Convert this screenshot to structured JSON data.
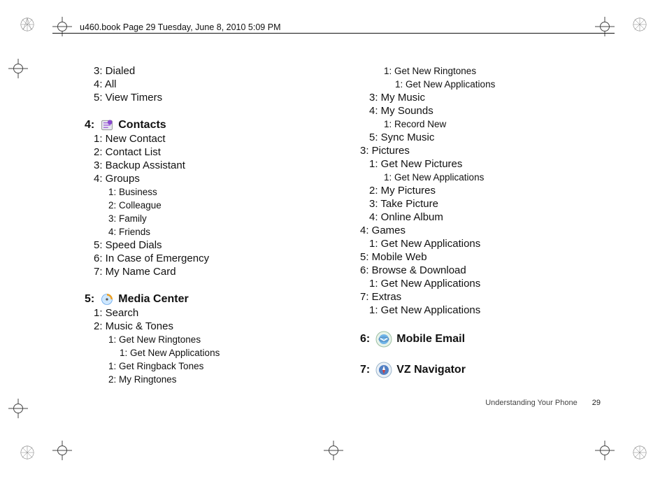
{
  "header": {
    "label": "u460.book  Page 29  Tuesday, June 8, 2010  5:09 PM"
  },
  "footer": {
    "section": "Understanding Your Phone",
    "page": "29"
  },
  "col_left": {
    "prelude": [
      {
        "lvl": 1,
        "text": "3: Dialed"
      },
      {
        "lvl": 1,
        "text": "4: All"
      },
      {
        "lvl": 1,
        "text": "5: View Timers"
      }
    ],
    "sections": [
      {
        "num": "4:",
        "title": "Contacts",
        "icon": "contacts-icon",
        "items": [
          {
            "lvl": 1,
            "text": "1: New Contact"
          },
          {
            "lvl": 1,
            "text": "2: Contact List"
          },
          {
            "lvl": 1,
            "text": "3: Backup Assistant"
          },
          {
            "lvl": 1,
            "text": "4: Groups"
          },
          {
            "lvl": 2,
            "text": "1: Business"
          },
          {
            "lvl": 2,
            "text": "2: Colleague"
          },
          {
            "lvl": 2,
            "text": "3: Family"
          },
          {
            "lvl": 2,
            "text": "4: Friends"
          },
          {
            "lvl": 1,
            "text": "5: Speed Dials"
          },
          {
            "lvl": 1,
            "text": "6: In Case of Emergency"
          },
          {
            "lvl": 1,
            "text": "7: My Name Card"
          }
        ]
      },
      {
        "num": "5:",
        "title": "Media Center",
        "icon": "media-icon",
        "items": [
          {
            "lvl": 1,
            "text": "1: Search"
          },
          {
            "lvl": 1,
            "text": "2: Music & Tones"
          },
          {
            "lvl": 2,
            "text": "1: Get New Ringtones"
          },
          {
            "lvl": 3,
            "text": "1: Get New Applications"
          },
          {
            "lvl": 2,
            "text": "1: Get Ringback Tones"
          },
          {
            "lvl": 2,
            "text": "2: My Ringtones"
          }
        ]
      }
    ]
  },
  "col_right": {
    "prelude": [
      {
        "lvl": 2,
        "text": "1: Get New Ringtones"
      },
      {
        "lvl": 3,
        "text": "1: Get New Applications"
      },
      {
        "lvl": 1,
        "text": "3: My Music"
      },
      {
        "lvl": 1,
        "text": "4: My Sounds"
      },
      {
        "lvl": 2,
        "text": "1: Record New"
      },
      {
        "lvl": 1,
        "text": "5: Sync Music"
      },
      {
        "lvl": 0,
        "text": "3: Pictures"
      },
      {
        "lvl": 1,
        "text": "1: Get New Pictures"
      },
      {
        "lvl": 2,
        "text": "1: Get New Applications"
      },
      {
        "lvl": 1,
        "text": "2: My Pictures"
      },
      {
        "lvl": 1,
        "text": "3: Take Picture"
      },
      {
        "lvl": 1,
        "text": "4: Online Album"
      },
      {
        "lvl": 0,
        "text": "4:  Games"
      },
      {
        "lvl": 1,
        "text": "1: Get New Applications"
      },
      {
        "lvl": 0,
        "text": "5: Mobile Web"
      },
      {
        "lvl": 0,
        "text": "6: Browse & Download"
      },
      {
        "lvl": 1,
        "text": "1: Get New Applications"
      },
      {
        "lvl": 0,
        "text": "7: Extras"
      },
      {
        "lvl": 1,
        "text": "1: Get New Applications"
      }
    ],
    "sections": [
      {
        "num": "6:",
        "title": "Mobile Email",
        "icon": "mobile-email-icon",
        "big": true,
        "items": []
      },
      {
        "num": "7:",
        "title": "VZ Navigator",
        "icon": "vz-navigator-icon",
        "big": true,
        "items": []
      }
    ]
  }
}
